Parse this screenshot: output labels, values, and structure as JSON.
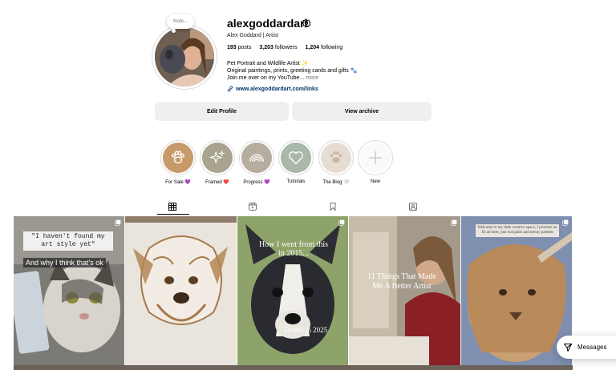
{
  "profile": {
    "note_label": "Note...",
    "username": "alexgoddardart",
    "fullname": "Alex Goddard | Artist",
    "stats": {
      "posts_count": "193",
      "posts_label": "posts",
      "followers_count": "3,203",
      "followers_label": "followers",
      "following_count": "1,204",
      "following_label": "following"
    },
    "bio_lines": [
      "Pet Portrait and Wildlife Artist ✨",
      "Original paintings, prints, greeting cards and gifts 🐾",
      "Join me over on my YouTube..."
    ],
    "bio_more": "more",
    "link": "www.alexgoddardart.com/links"
  },
  "buttons": {
    "edit_profile": "Edit Profile",
    "view_archive": "View archive"
  },
  "highlights": [
    {
      "label": "For Sale 💜"
    },
    {
      "label": "Framed ❤️"
    },
    {
      "label": "Progress 💜"
    },
    {
      "label": "Tutorials"
    },
    {
      "label": "The Blog 🤍"
    },
    {
      "label": "New"
    }
  ],
  "posts": [
    {
      "text_top": "\"I haven't found my art style yet\"",
      "text_bottom": "And why I think that's ok"
    },
    {
      "text_top": ""
    },
    {
      "text_top": "How I went from this in 2015...",
      "text_bottom": "To this in 2025"
    },
    {
      "text_top": "11 Things That Made Me A Better Artist"
    },
    {
      "text_top": "Welcome to my little creative space, I promise no AI art here, just real paint and messy palettes"
    }
  ],
  "messages_label": "Messages"
}
